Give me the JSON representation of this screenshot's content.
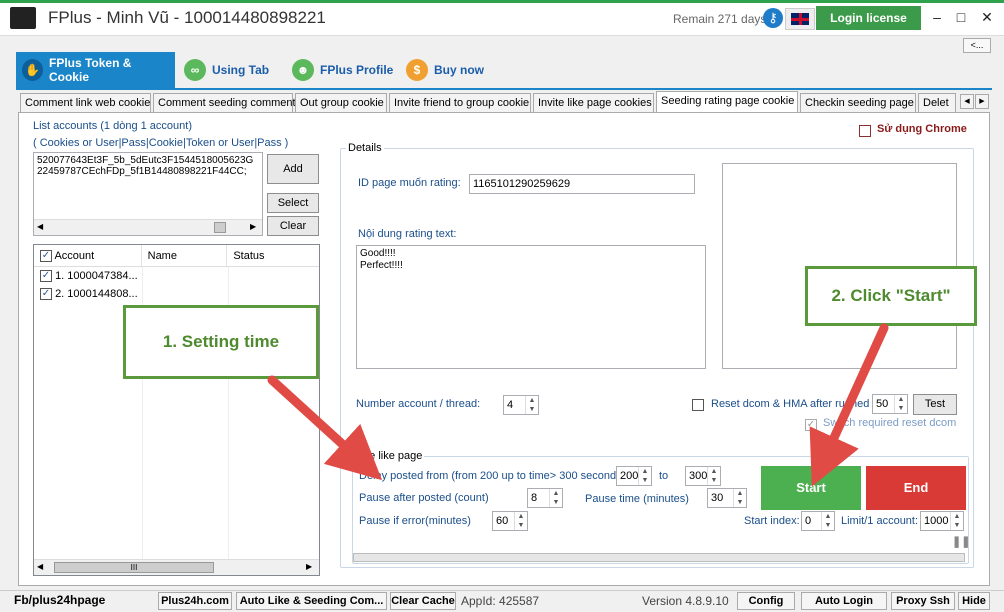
{
  "window": {
    "title": "FPlus - Minh Vũ - 100014480898221",
    "remain": "Remain 271 days",
    "login_label": "Login license",
    "collapse_label": "<..."
  },
  "top_tabs": [
    {
      "label": "FPlus Token & Cookie",
      "icon": "fingerprint-icon"
    },
    {
      "label": "Using Tab",
      "icon": "link-icon"
    },
    {
      "label": "FPlus Profile",
      "icon": "users-icon"
    },
    {
      "label": "Buy now",
      "icon": "refresh-dollar-icon"
    }
  ],
  "sub_tabs": [
    "Comment link web cookie",
    "Comment seeding comment",
    "Out group cookie",
    "Invite friend to group cookie",
    "Invite like page cookies",
    "Seeding rating page cookie",
    "Checkin seeding page",
    "Delet"
  ],
  "accounts": {
    "label1": "List accounts (1 dòng 1 account)",
    "label2": "( Cookies or User|Pass|Cookie|Token or User|Pass )",
    "text": "520077643Et3F_5b_5dEutc3F1544518005623G\n22459787CEchFDp_5f1B14480898221F44CC;",
    "add_label": "Add",
    "select_label": "Select",
    "clear_label": "Clear"
  },
  "grid": {
    "headers": [
      "Account",
      "Name",
      "Status"
    ],
    "rows": [
      {
        "account": "1. 1000047384...",
        "name": "",
        "status": ""
      },
      {
        "account": "2. 1000144808...",
        "name": "",
        "status": ""
      }
    ],
    "scroll_label": "III"
  },
  "options": {
    "use_chrome_label": "Sử dụng Chrome",
    "details_label": "Details"
  },
  "details": {
    "id_label": "ID page muốn rating:",
    "id_value": "1165101290259629",
    "text_label": "Nội dung rating text:",
    "text_value": "Good!!!!\nPerfect!!!!",
    "number_label": "Number account / thread:",
    "number_value": "4",
    "reset_label": "Reset dcom & HMA after runned",
    "reset_value": "50",
    "test_label": "Test",
    "switch_label": "Switch required reset dcom"
  },
  "invite": {
    "group_label": "Invite like page",
    "delay_label": "Delay posted from (from 200 up to time> 300 seconds)",
    "delay_from": "200",
    "to_label": "to",
    "delay_to": "300",
    "pause_posted_label": "Pause after posted (count)",
    "pause_posted_value": "8",
    "pause_time_label": "Pause time (minutes)",
    "pause_time_value": "30",
    "pause_error_label": "Pause if error(minutes)",
    "pause_error_value": "60",
    "start_index_label": "Start index:",
    "start_index_value": "0",
    "limit_label": "Limit/1 account:",
    "limit_value": "1000",
    "start_label": "Start",
    "end_label": "End"
  },
  "callouts": {
    "one": "1. Setting time",
    "two": "2. Click \"Start\""
  },
  "statusbar": {
    "left": "Fb/plus24hpage",
    "buttons": [
      "Plus24h.com",
      "Auto Like & Seeding Com...",
      "Clear Cache"
    ],
    "appid": "AppId: 425587",
    "version": "Version 4.8.9.10",
    "right_buttons": [
      "Config",
      "Auto Login",
      "Proxy Ssh",
      "Hide"
    ]
  },
  "colors": {
    "accent": "#1a85c8",
    "login_green": "#3c9b4a",
    "start_green": "#4caf50",
    "end_red": "#d93a36",
    "callout_green": "#5b9a3c",
    "arrow_red": "#e04b45"
  }
}
